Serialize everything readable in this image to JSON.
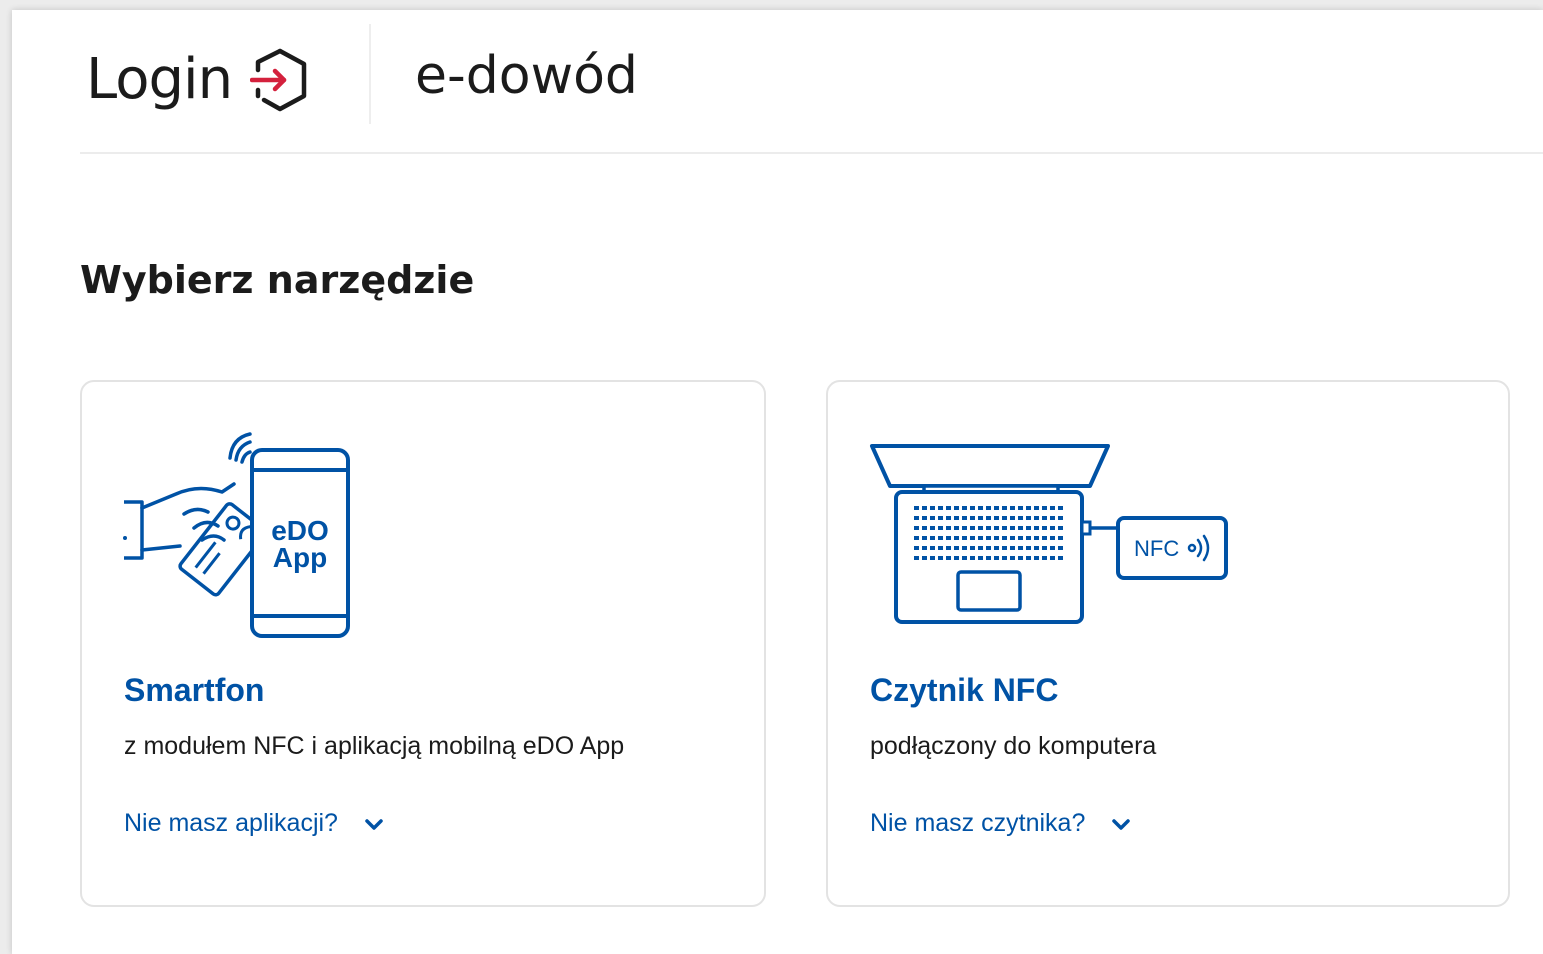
{
  "header": {
    "login_label": "Login",
    "service_name": "e-dowód"
  },
  "main": {
    "title": "Wybierz narzędzie",
    "cards": [
      {
        "title": "Smartfon",
        "description": "z modułem NFC i aplikacją mobilną eDO App",
        "link": "Nie masz aplikacji?",
        "illustration": {
          "icon": "phone-card-icon",
          "line1": "eDO",
          "line2": "App"
        }
      },
      {
        "title": "Czytnik NFC",
        "description": "podłączony do komputera",
        "link": "Nie masz czytnika?",
        "illustration": {
          "icon": "laptop-nfc-reader-icon",
          "reader_label": "NFC"
        }
      }
    ]
  },
  "colors": {
    "brand_blue": "#0052a5",
    "accent_red": "#d4213d",
    "text": "#1b1b1b"
  }
}
